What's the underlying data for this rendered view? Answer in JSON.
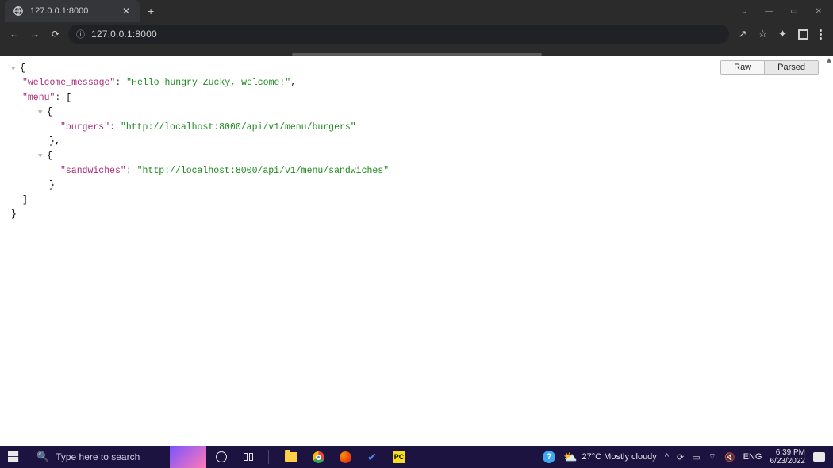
{
  "browser": {
    "tab_title": "127.0.0.1:8000",
    "url_display": "127.0.0.1:8000",
    "url_scheme_hidden": ""
  },
  "win_controls": {
    "chevron": "⌄",
    "minimize": "—",
    "maximize": "▭",
    "close": "✕"
  },
  "nav": {
    "back": "←",
    "forward": "→",
    "reload": "⟳"
  },
  "addr_icons": {
    "share": "↗",
    "star": "☆",
    "extensions": "✦"
  },
  "json_view": {
    "toggle": {
      "raw": "Raw",
      "parsed": "Parsed",
      "active": "parsed"
    },
    "content": {
      "welcome_message_key": "\"welcome_message\"",
      "welcome_message_val": "\"Hello hungry Zucky, welcome!\"",
      "menu_key": "\"menu\"",
      "item1_key": "\"burgers\"",
      "item1_val": "\"http://localhost:8000/api/v1/menu/burgers\"",
      "item2_key": "\"sandwiches\"",
      "item2_val": "\"http://localhost:8000/api/v1/menu/sandwiches\""
    }
  },
  "taskbar": {
    "search_placeholder": "Type here to search",
    "weather_text": "27°C Mostly cloudy",
    "lang": "ENG",
    "time": "6:39 PM",
    "date": "6/23/2022",
    "py_label": "PC"
  },
  "sys_tray": {
    "chevron": "^",
    "update": "⟳",
    "battery": "▭",
    "wifi": "⌔",
    "volume": "🔇"
  }
}
